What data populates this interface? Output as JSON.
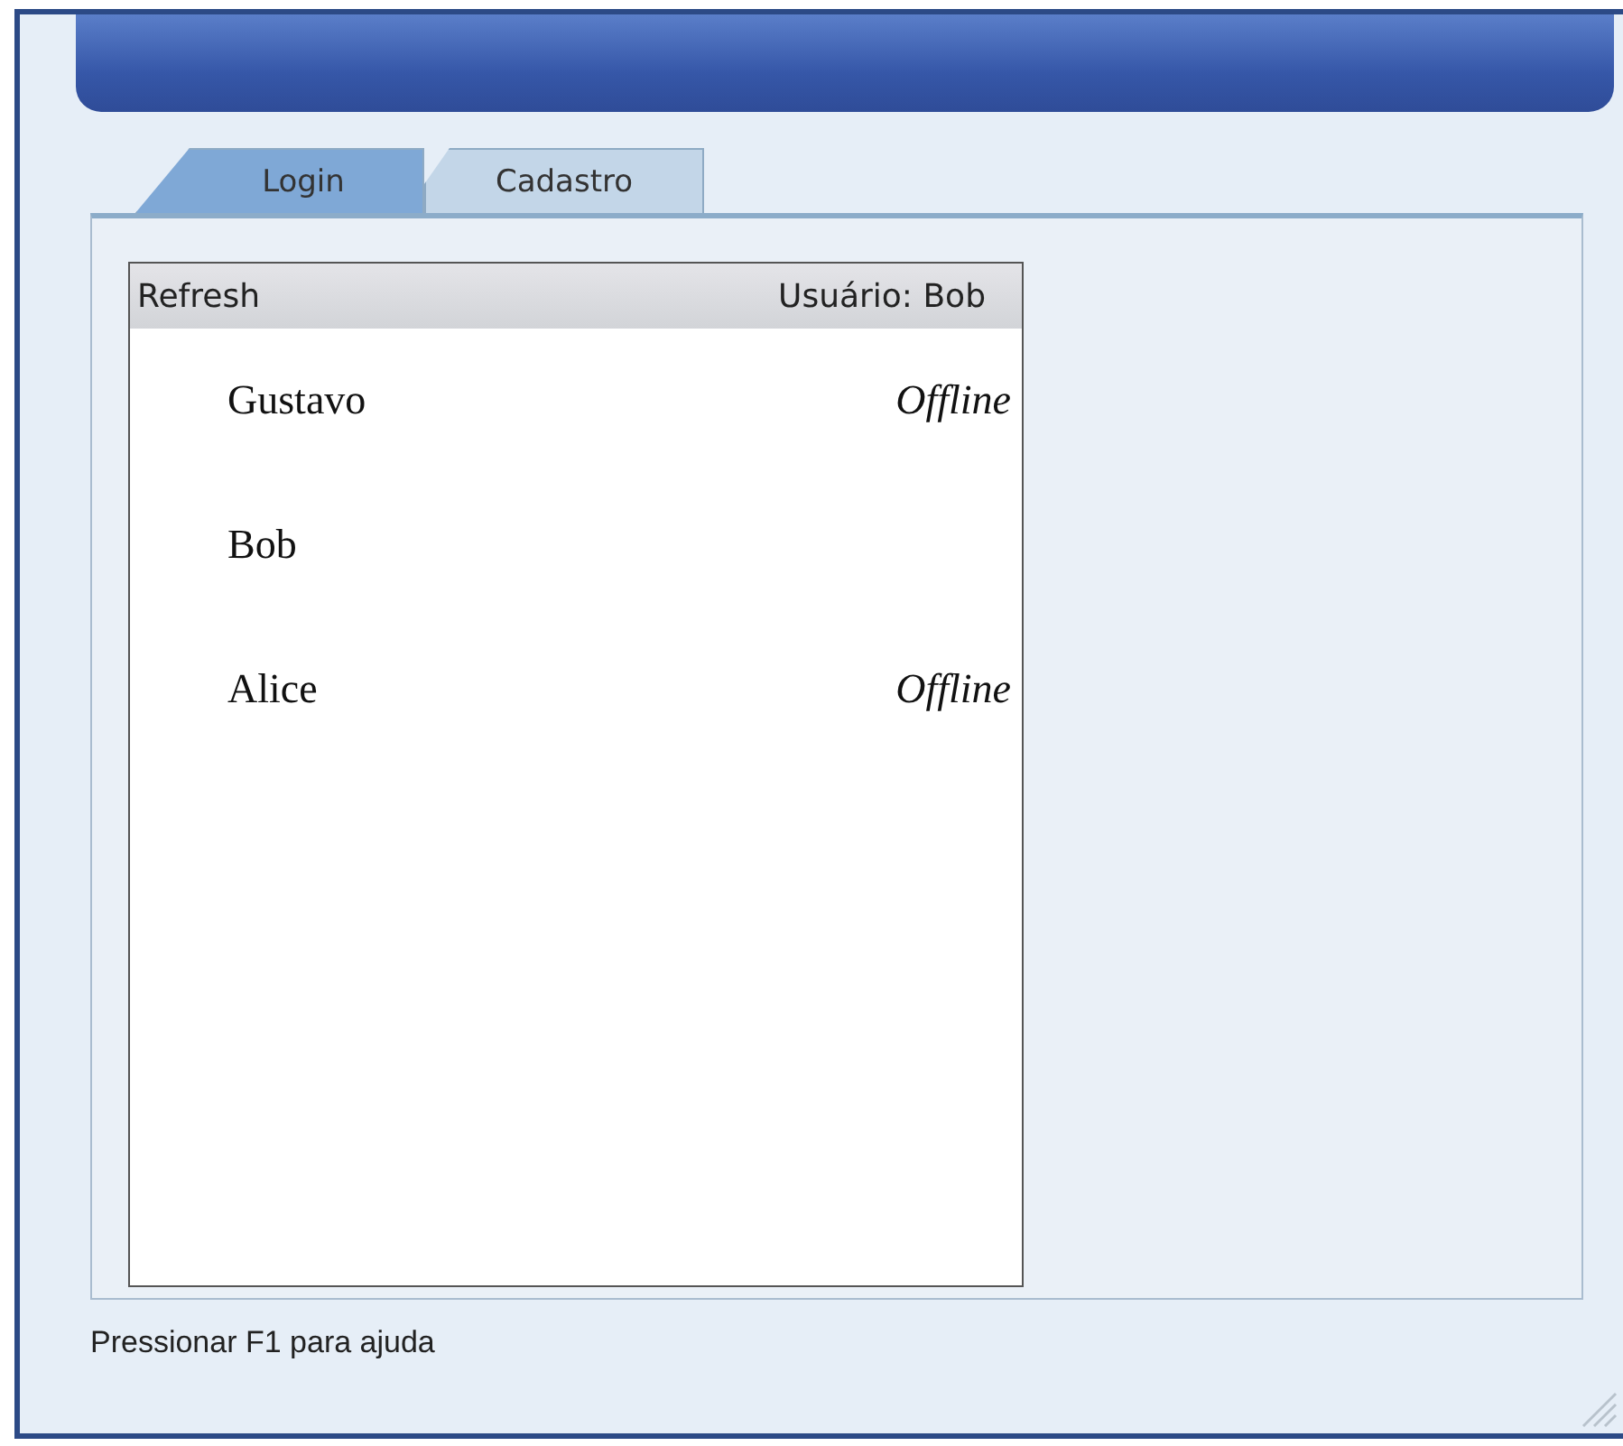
{
  "tabs": [
    {
      "label": "Login",
      "selected": true
    },
    {
      "label": "Cadastro",
      "selected": false
    }
  ],
  "list": {
    "refresh": "Refresh",
    "user": "Usuário: Bob",
    "rows": [
      {
        "name": "Gustavo",
        "status": "Offline"
      },
      {
        "name": "Bob"
      },
      {
        "name": "Alice",
        "status": "Offline"
      }
    ]
  },
  "status_bar": "Pressionar F1 para ajuda"
}
